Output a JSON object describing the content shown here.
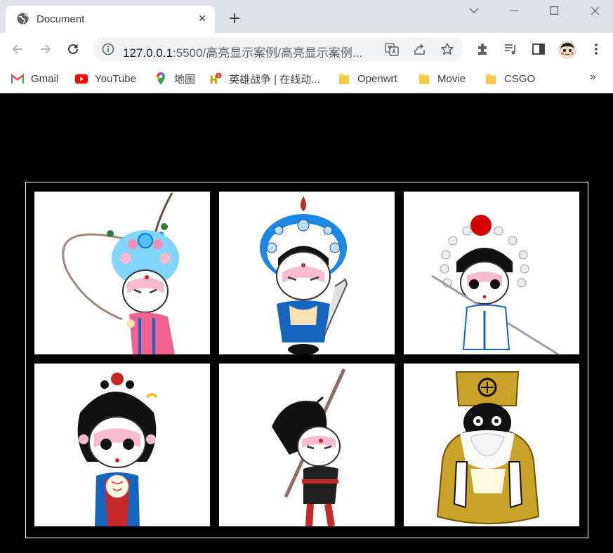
{
  "tab": {
    "title": "Document",
    "close": "×"
  },
  "address": {
    "host": "127.0.0.1",
    "rest": ":5500/高亮显示案例/高亮显示案例..."
  },
  "bookmarks": [
    {
      "label": "Gmail",
      "icon": "gmail-icon"
    },
    {
      "label": "YouTube",
      "icon": "youtube-icon"
    },
    {
      "label": "地圖",
      "icon": "maps-icon"
    },
    {
      "label": "英雄战争 | 在线动...",
      "icon": "game-icon"
    },
    {
      "label": "Openwrt",
      "icon": "folder-icon"
    },
    {
      "label": "Movie",
      "icon": "folder-icon"
    },
    {
      "label": "CSGO",
      "icon": "folder-icon"
    }
  ],
  "more": "»",
  "gallery": [
    {
      "icon": "opera-general-pheasant-feather-image"
    },
    {
      "icon": "opera-young-man-sword-image"
    },
    {
      "icon": "opera-warrior-spear-image"
    },
    {
      "icon": "opera-lady-fan-image"
    },
    {
      "icon": "opera-monk-staff-image"
    },
    {
      "icon": "opera-official-gold-robe-image"
    }
  ],
  "colors": {
    "tabstrip": "#dee1e6",
    "page_bg": "#000000",
    "frame_border": "#ffffff"
  }
}
